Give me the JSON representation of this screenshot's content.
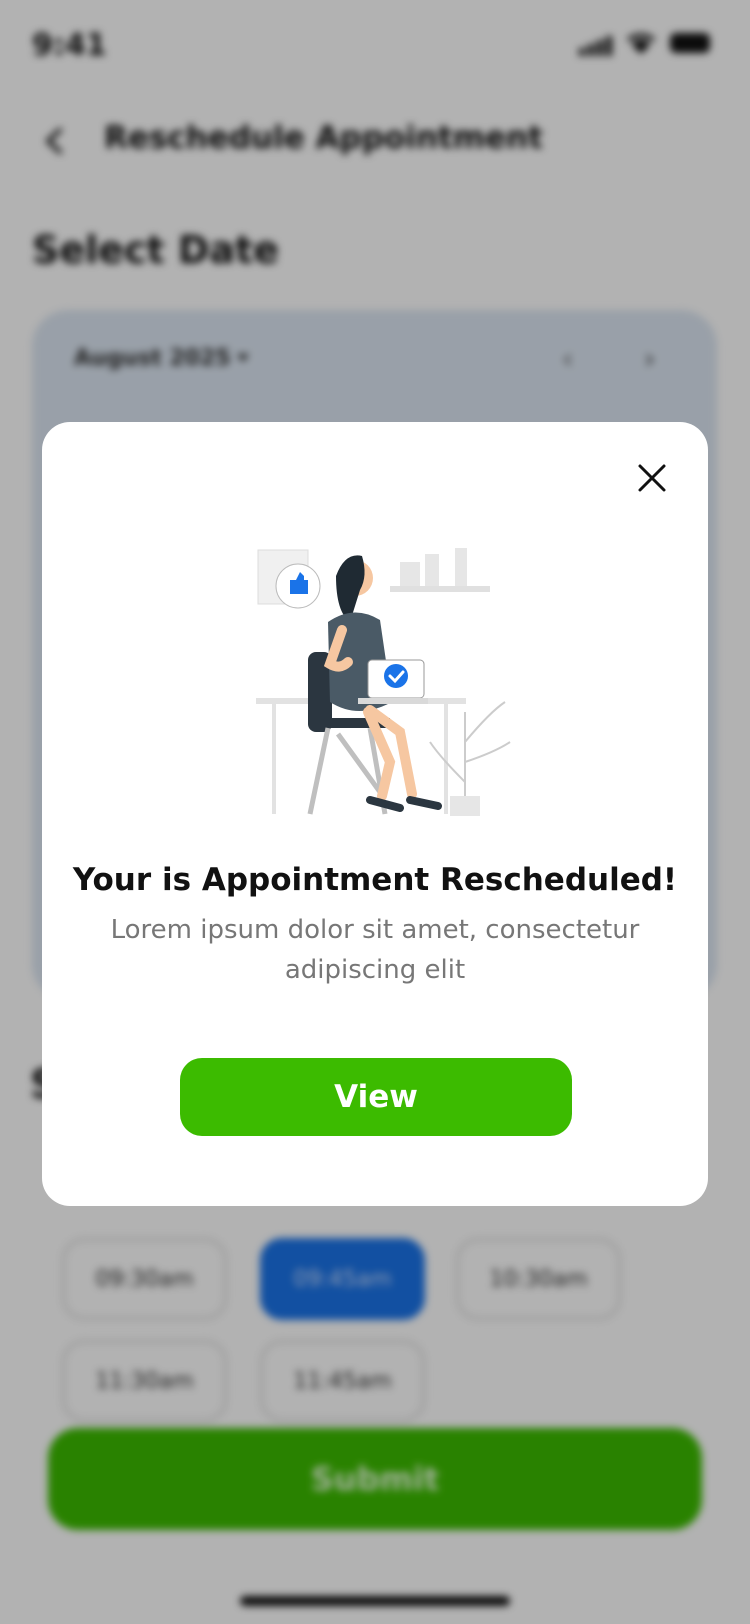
{
  "status_bar": {
    "time": "9:41"
  },
  "header": {
    "title": "Reschedule Appointment"
  },
  "page": {
    "select_date_title": "Select Date"
  },
  "calendar": {
    "month_label": "August 2025"
  },
  "time_slots": {
    "section_title_fragment": "S",
    "row1": [
      {
        "label": "09:30am",
        "selected": false
      },
      {
        "label": "09:45am",
        "selected": true
      },
      {
        "label": "10:30am",
        "selected": false
      }
    ],
    "row2": [
      {
        "label": "11:30am",
        "selected": false
      },
      {
        "label": "11:45am",
        "selected": false
      }
    ]
  },
  "footer": {
    "submit_label": "Submit"
  },
  "modal": {
    "title": "Your is Appointment Rescheduled!",
    "subtitle": "Lorem ipsum dolor sit amet, consectetur adipiscing elit",
    "view_label": "View",
    "illustration_icon": "person-with-laptop-illustration",
    "close_icon": "close-icon"
  },
  "colors": {
    "primary_green": "#3cbb00",
    "selected_blue": "#1a73e8",
    "overlay": "rgba(0,0,0,0.30)"
  }
}
